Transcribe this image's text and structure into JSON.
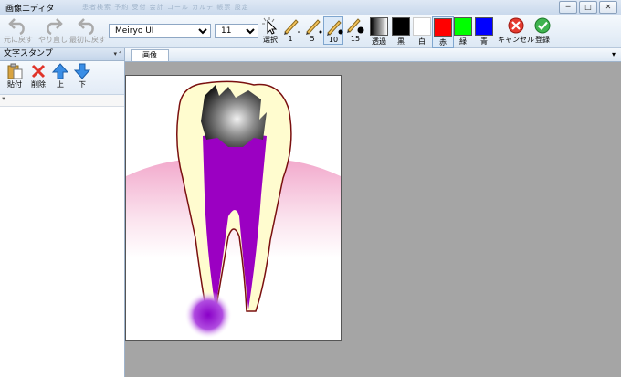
{
  "window": {
    "title": "画像エディタ",
    "bg_menu": "患者検索   予約   受付   会計   コール   カルテ   帳票   設定",
    "buttons": {
      "minimize": "─",
      "restore": "□",
      "close": "✕"
    }
  },
  "toolbar": {
    "undo": "元に戻す",
    "redo": "やり直し",
    "reset": "最初に戻す",
    "font_value": "Meiryo UI",
    "size_value": "11",
    "select": "選択",
    "pens": [
      "1",
      "5",
      "10",
      "15"
    ],
    "colors": [
      {
        "label": "透過",
        "hex": "gradient"
      },
      {
        "label": "黒",
        "hex": "#000000"
      },
      {
        "label": "白",
        "hex": "#ffffff"
      },
      {
        "label": "赤",
        "hex": "#ff0000"
      },
      {
        "label": "緑",
        "hex": "#00ff00"
      },
      {
        "label": "青",
        "hex": "#0000ff"
      }
    ],
    "cancel": "キャンセル",
    "register": "登録"
  },
  "panel": {
    "title": "文字スタンプ",
    "controls": "▾ ⁴",
    "paste": "貼付",
    "delete": "削除",
    "up": "上",
    "down": "下",
    "row_marker": "*"
  },
  "document": {
    "tab": "画像",
    "tab_menu": "▾"
  }
}
